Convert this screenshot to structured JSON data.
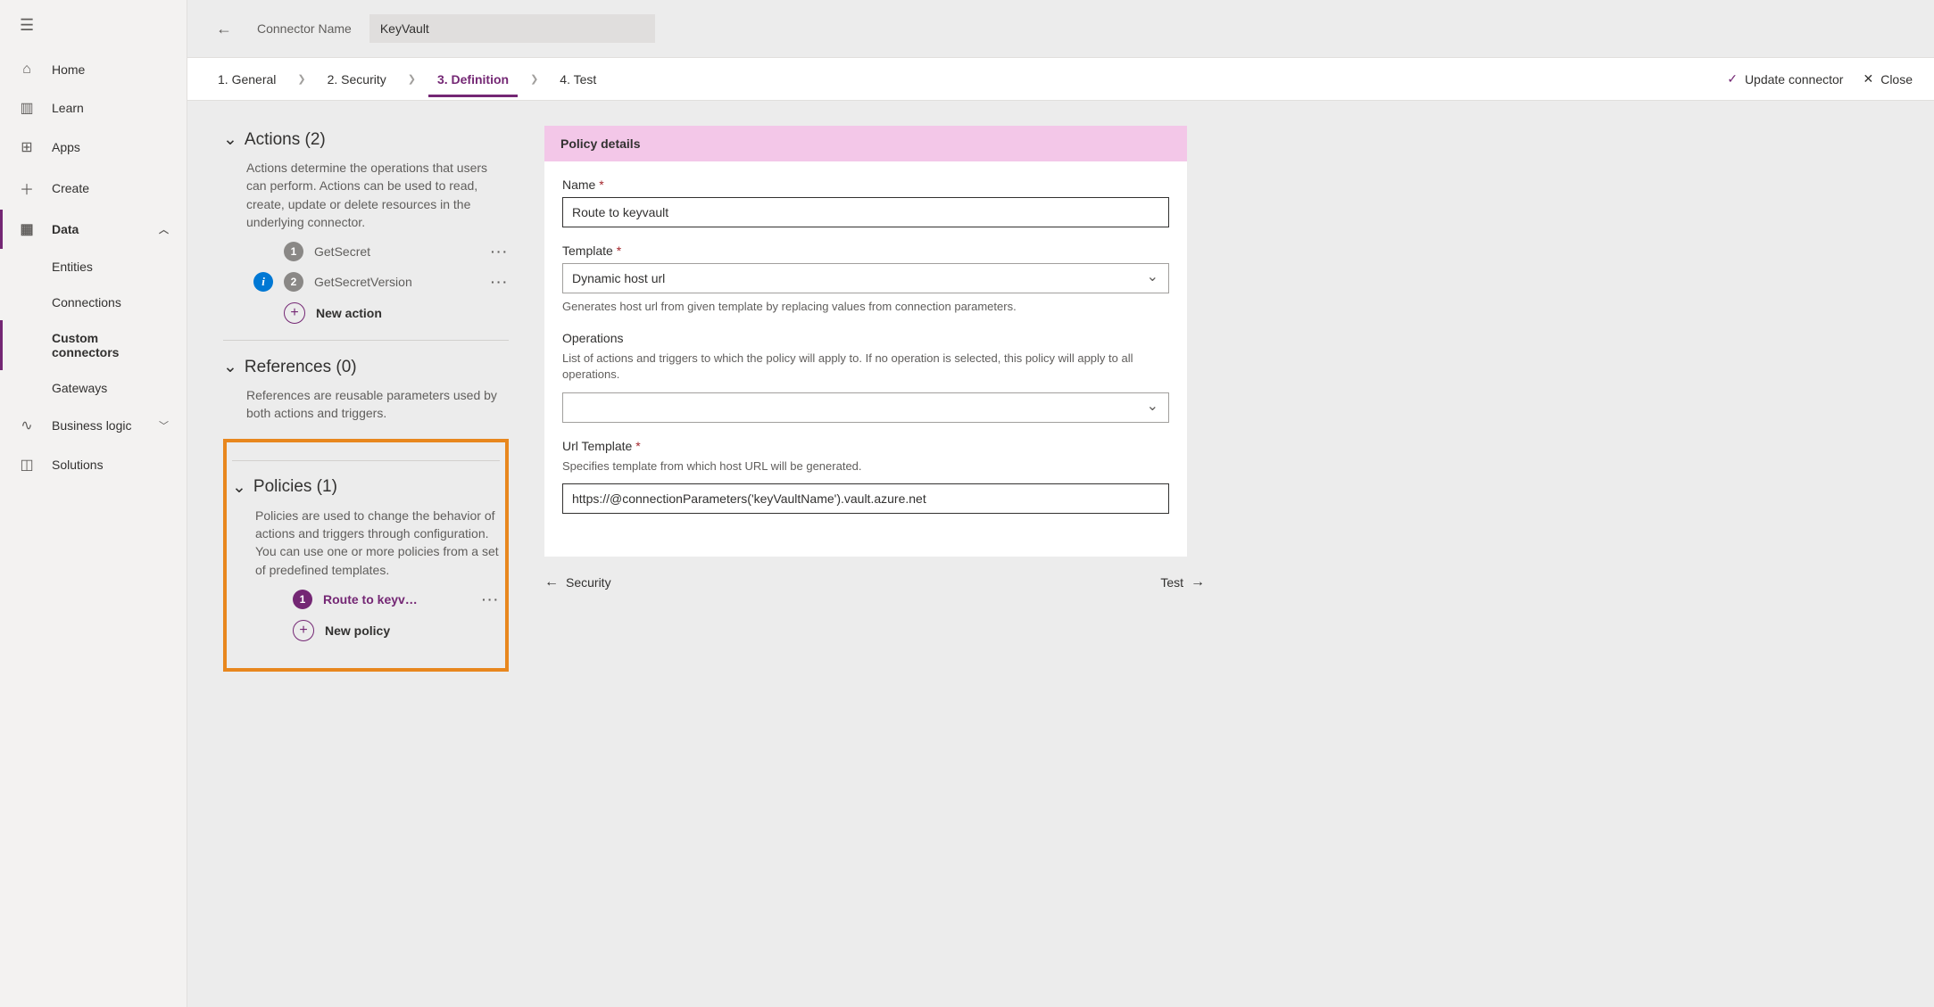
{
  "nav": {
    "home": "Home",
    "learn": "Learn",
    "apps": "Apps",
    "create": "Create",
    "data": "Data",
    "entities": "Entities",
    "connections": "Connections",
    "custom_connectors": "Custom connectors",
    "gateways": "Gateways",
    "business_logic": "Business logic",
    "solutions": "Solutions"
  },
  "header": {
    "label": "Connector Name",
    "value": "KeyVault"
  },
  "tabs": {
    "t1": "1. General",
    "t2": "2. Security",
    "t3": "3. Definition",
    "t4": "4. Test",
    "update": "Update connector",
    "close": "Close"
  },
  "actions": {
    "title": "Actions (2)",
    "desc": "Actions determine the operations that users can perform. Actions can be used to read, create, update or delete resources in the underlying connector.",
    "a1": "GetSecret",
    "a2": "GetSecretVersion",
    "new": "New action"
  },
  "references": {
    "title": "References (0)",
    "desc": "References are reusable parameters used by both actions and triggers."
  },
  "policies": {
    "title": "Policies (1)",
    "desc": "Policies are used to change the behavior of actions and triggers through configuration. You can use one or more policies from a set of predefined templates.",
    "p1": "Route to keyv…",
    "new": "New policy"
  },
  "details": {
    "header": "Policy details",
    "name_label": "Name",
    "name_value": "Route to keyvault",
    "template_label": "Template",
    "template_value": "Dynamic host url",
    "template_help": "Generates host url from given template by replacing values from connection parameters.",
    "operations_label": "Operations",
    "operations_help": "List of actions and triggers to which the policy will apply to. If no operation is selected, this policy will apply to all operations.",
    "url_label": "Url Template",
    "url_help": "Specifies template from which host URL will be generated.",
    "url_value": "https://@connectionParameters('keyVaultName').vault.azure.net"
  },
  "footer": {
    "prev": "Security",
    "next": "Test"
  }
}
